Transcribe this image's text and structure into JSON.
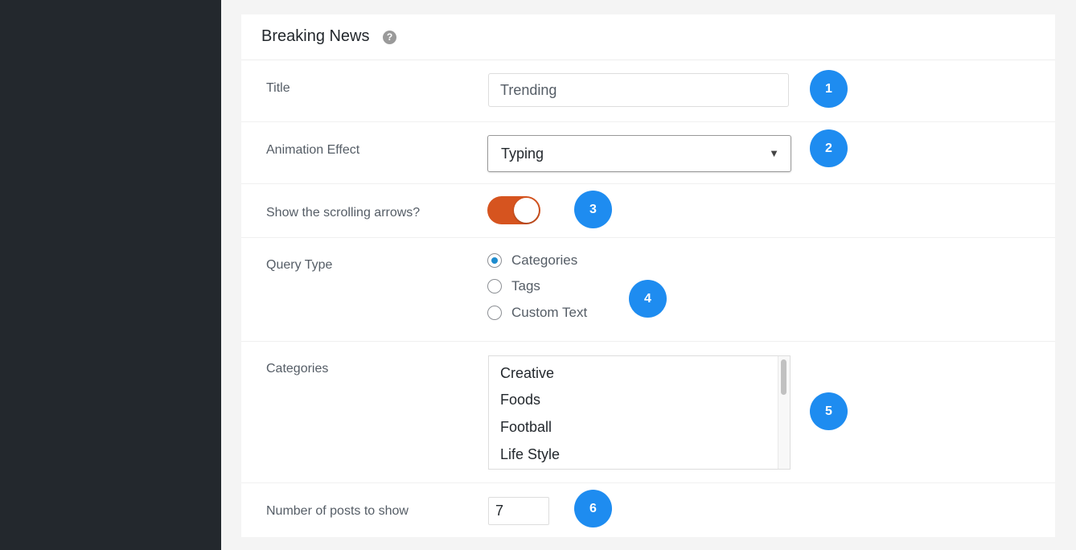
{
  "panel": {
    "title": "Breaking News",
    "help_icon": "?"
  },
  "fields": {
    "title": {
      "label": "Title",
      "value": "Trending",
      "badge": "1"
    },
    "animation": {
      "label": "Animation Effect",
      "value": "Typing",
      "arrow": "▼",
      "badge": "2"
    },
    "arrows": {
      "label": "Show the scrolling arrows?",
      "state": "on",
      "badge": "3"
    },
    "query_type": {
      "label": "Query Type",
      "options": [
        "Categories",
        "Tags",
        "Custom Text"
      ],
      "selected": "Categories",
      "badge": "4"
    },
    "categories": {
      "label": "Categories",
      "items": [
        "Creative",
        "Foods",
        "Football",
        "Life Style"
      ],
      "badge": "5"
    },
    "posts": {
      "label": "Number of posts to show",
      "value": "7",
      "badge": "6"
    }
  },
  "colors": {
    "sidebar": "#23282d",
    "badge": "#1e8cf0",
    "toggle_on": "#d6541f",
    "radio_checked": "#1e8cce"
  }
}
